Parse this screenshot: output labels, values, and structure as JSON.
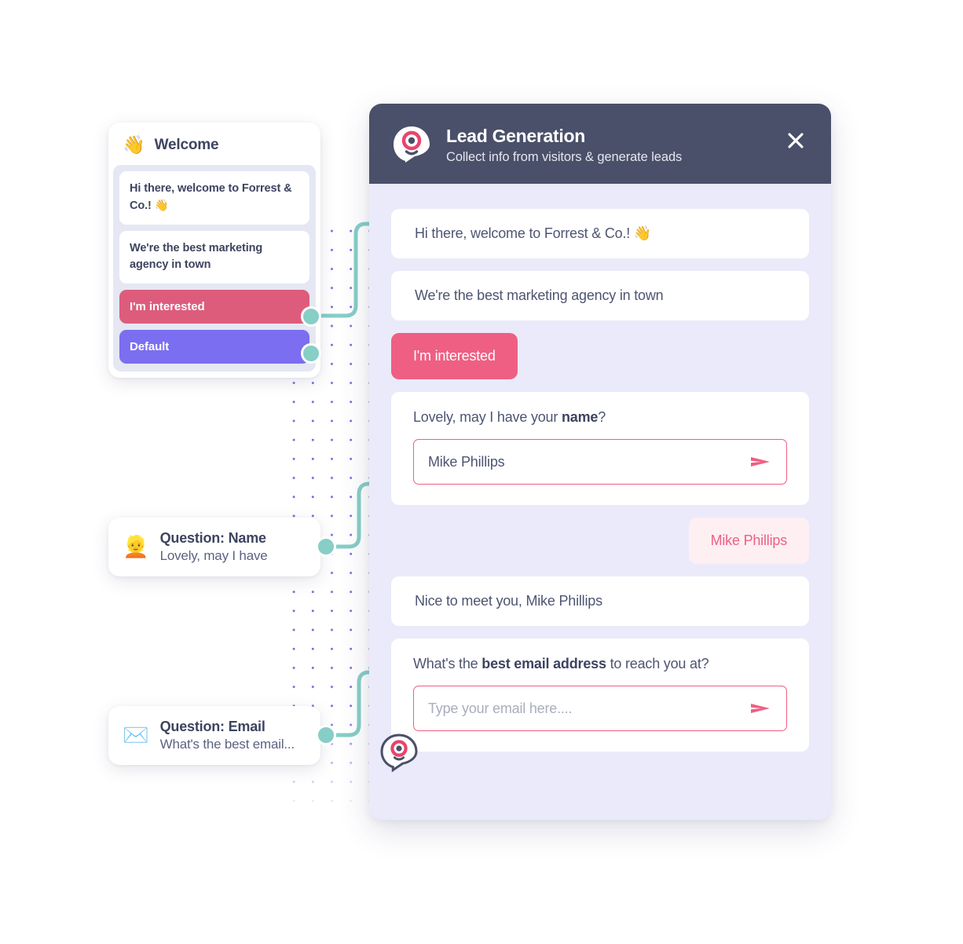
{
  "colors": {
    "header_bg": "#4a5069",
    "chat_bg": "#ebeafa",
    "accent_pink": "#ef5f83",
    "option_pink": "#dd5c7c",
    "option_purple": "#7b6ef0",
    "connector_teal": "#86cec6",
    "dot_grid": "#5b51e8",
    "user_bubble_bg": "#fdeff2",
    "text_dark": "#3d4460"
  },
  "flow": {
    "nodes": [
      {
        "id": "welcome",
        "emoji": "👋",
        "emoji_name": "waving-hand-emoji",
        "title": "Welcome",
        "messages": [
          "Hi there, welcome to Forrest & Co.! 👋",
          "We're the best marketing agency in town"
        ],
        "options": [
          {
            "label": "I'm interested",
            "color": "#dd5c7c"
          },
          {
            "label": "Default",
            "color": "#7b6ef0"
          }
        ]
      },
      {
        "id": "question-name",
        "emoji": "👱",
        "emoji_name": "person-blond-hair-emoji",
        "title": "Question: Name",
        "subtitle": "Lovely, may I have"
      },
      {
        "id": "question-email",
        "emoji": "✉️",
        "emoji_name": "envelope-emoji",
        "title": "Question: Email",
        "subtitle": "What's the best email..."
      }
    ]
  },
  "widget": {
    "header": {
      "logo_name": "lead-generation-logo",
      "title": "Lead Generation",
      "subtitle": "Collect info from  visitors & generate leads",
      "close_label": "✕"
    },
    "conversation": [
      {
        "type": "bot",
        "text": "Hi there, welcome to Forrest & Co.! 👋"
      },
      {
        "type": "bot",
        "text": "We're the best marketing agency in town"
      },
      {
        "type": "option",
        "text": "I'm interested"
      },
      {
        "type": "question",
        "prompt_before": "Lovely, may I have your ",
        "prompt_bold": "name",
        "prompt_after": "?",
        "input_value": "Mike Phillips",
        "input_placeholder": "",
        "send_icon": "send-arrow-icon"
      },
      {
        "type": "user",
        "text": "Mike Phillips"
      },
      {
        "type": "bot",
        "text": "Nice to meet you, Mike Phillips"
      },
      {
        "type": "question",
        "prompt_before": "What's the ",
        "prompt_bold": "best email address",
        "prompt_after": " to reach you at?",
        "input_value": "",
        "input_placeholder": "Type your email here....",
        "send_icon": "send-arrow-icon"
      }
    ],
    "bot_avatar_name": "bot-avatar-icon"
  }
}
